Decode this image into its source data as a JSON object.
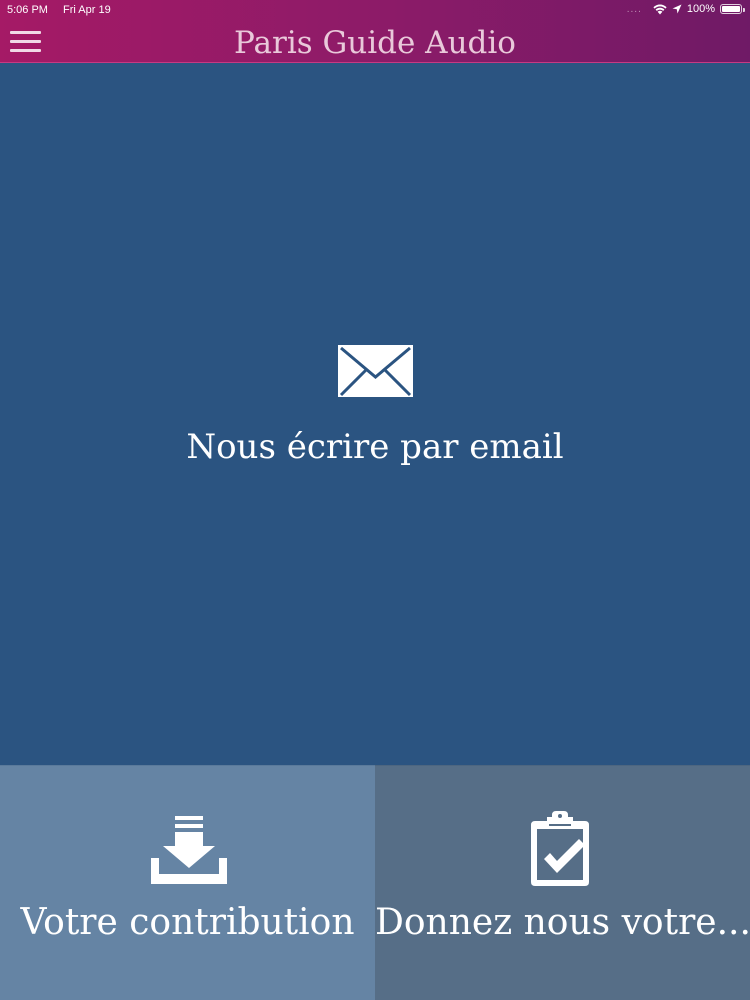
{
  "status_bar": {
    "time": "5:06 PM",
    "date": "Fri Apr 19",
    "signal_dots": "....",
    "battery": "100%"
  },
  "header": {
    "title": "Paris Guide Audio",
    "menu_icon": "hamburger-menu-icon"
  },
  "main": {
    "email_label": "Nous écrire par email",
    "email_icon": "envelope-icon"
  },
  "tiles": [
    {
      "label": "Votre contribution",
      "icon": "download-tray-icon"
    },
    {
      "label": "Donnez nous votre...",
      "icon": "clipboard-check-icon"
    }
  ],
  "colors": {
    "header_gradient_start": "#a51a66",
    "header_gradient_end": "#6f1a66",
    "main_background": "#2b5481",
    "tile_left": "#6584a4",
    "tile_right": "#566e87",
    "text": "#ffffff"
  }
}
